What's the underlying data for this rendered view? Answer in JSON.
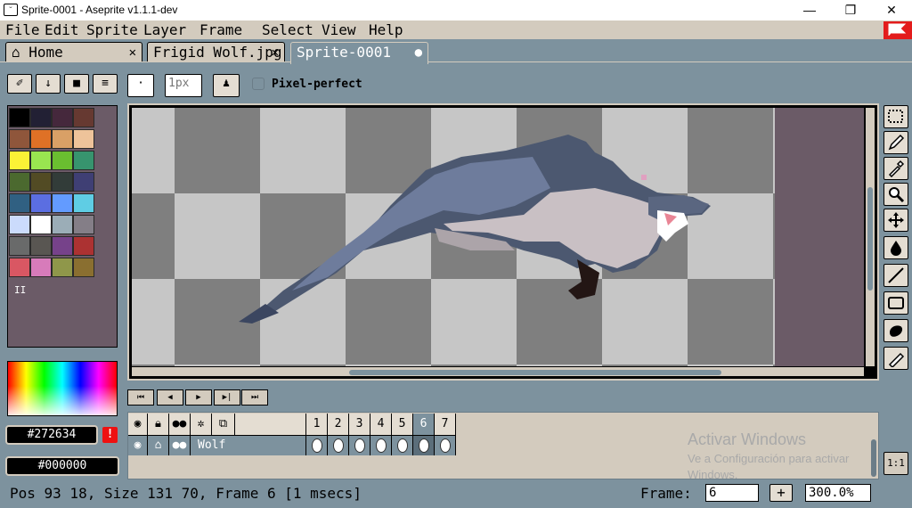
{
  "window": {
    "title": "Sprite-0001 - Aseprite v1.1.1-dev",
    "app_icon": "aseprite-face-icon",
    "controls": {
      "minimize": "—",
      "maximize": "❐",
      "close": "✕"
    }
  },
  "menu": {
    "items": [
      "File",
      "Edit",
      "Sprite",
      "Layer",
      "Frame",
      "Select",
      "View",
      "Help"
    ],
    "flag_icon": "red-flag-icon"
  },
  "tabs": [
    {
      "label": "Home",
      "icon": "home-icon",
      "close": "✕"
    },
    {
      "label": "Frigid Wolf.jpg",
      "close": "✕"
    },
    {
      "label": "Sprite-0001",
      "modified": "●"
    }
  ],
  "toolbar": {
    "brush_size": "1px",
    "brush_placeholder": "1px",
    "pixel_perfect_label": "Pixel-perfect",
    "pixel_perfect_checked": false
  },
  "palette": {
    "colors": [
      "#000000",
      "#222034",
      "#45283c",
      "#663931",
      "#8f563b",
      "#df7126",
      "#d9a066",
      "#eec39a",
      "#fbf236",
      "#99e550",
      "#6abe30",
      "#37946e",
      "#4b692f",
      "#524b24",
      "#323c39",
      "#3f3f74",
      "#306082",
      "#5b6ee1",
      "#639bff",
      "#5fcde4",
      "#cbdbfc",
      "#ffffff",
      "#9badb7",
      "#847e87",
      "#696a6a",
      "#595652",
      "#76428a",
      "#ac3232",
      "#d95763",
      "#d77bba",
      "#8f974a",
      "#8a6f30"
    ],
    "grip": "II",
    "background_color": "#6b5b67"
  },
  "colors": {
    "foreground": "#272634",
    "background": "#000000",
    "warning_icon": "!"
  },
  "tools": [
    "marquee-icon",
    "pencil-icon",
    "eyedropper-icon",
    "zoom-icon",
    "move-icon",
    "fill-icon",
    "line-icon",
    "rectangle-icon",
    "contour-icon",
    "blur-icon"
  ],
  "playback": [
    "⏮",
    "◀",
    "▶",
    "▶|",
    "⏭"
  ],
  "timeline": {
    "header_icons": [
      "eye-icon",
      "lock-icon",
      "continuous-icon",
      "gear-icon",
      "layers-icon"
    ],
    "frames": [
      "1",
      "2",
      "3",
      "4",
      "5",
      "6",
      "7"
    ],
    "active_frame": 6,
    "layers": [
      {
        "name": "Wolf"
      }
    ]
  },
  "watermark": {
    "line1": "Activar Windows",
    "line2": "Ve a Configuración para activar",
    "line3": "Windows."
  },
  "status": {
    "text": "Pos 93 18, Size 131 70, Frame 6 [1 msecs]",
    "frame_label": "Frame:",
    "frame_value": "6",
    "add_label": "+",
    "zoom": "300.0%",
    "zoom_reset": "1:1"
  }
}
